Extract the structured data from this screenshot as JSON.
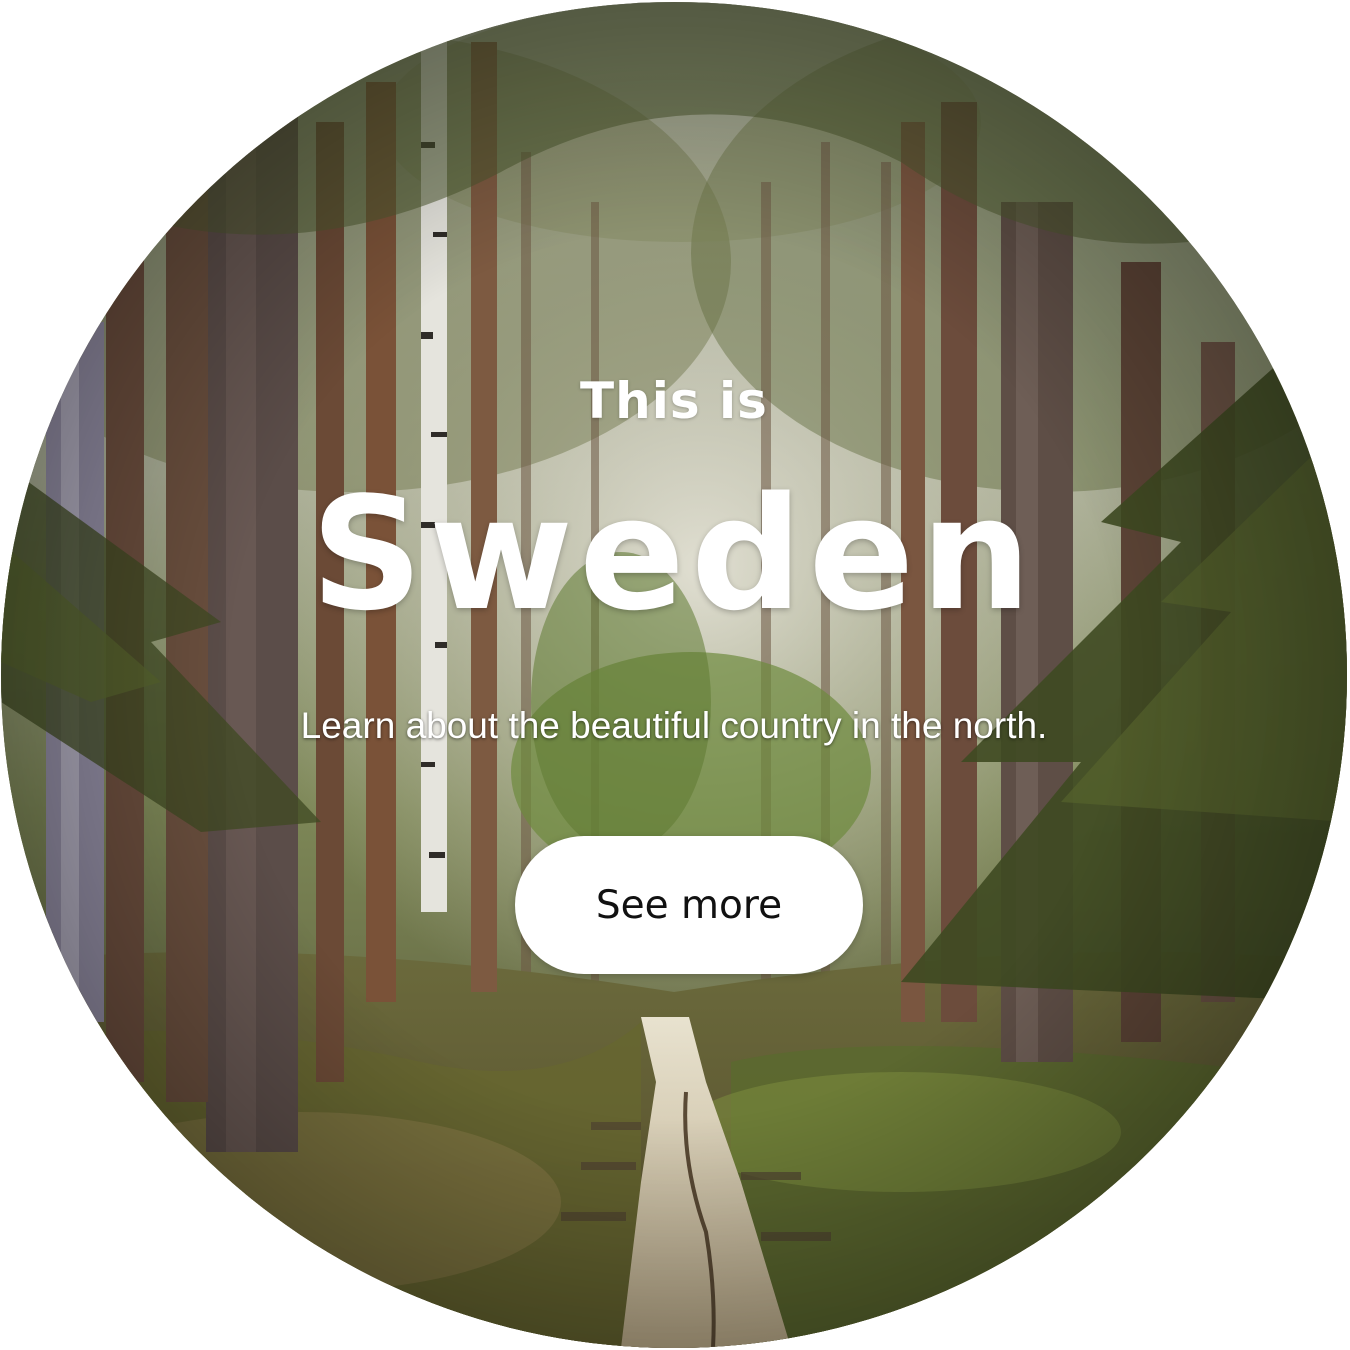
{
  "hero": {
    "eyebrow": "This is",
    "title": "Sweden",
    "subtitle": "Learn about the beautiful country in the north.",
    "cta_label": "See more"
  },
  "colors": {
    "text": "#ffffff",
    "button_bg": "#ffffff",
    "button_text": "#111111"
  }
}
